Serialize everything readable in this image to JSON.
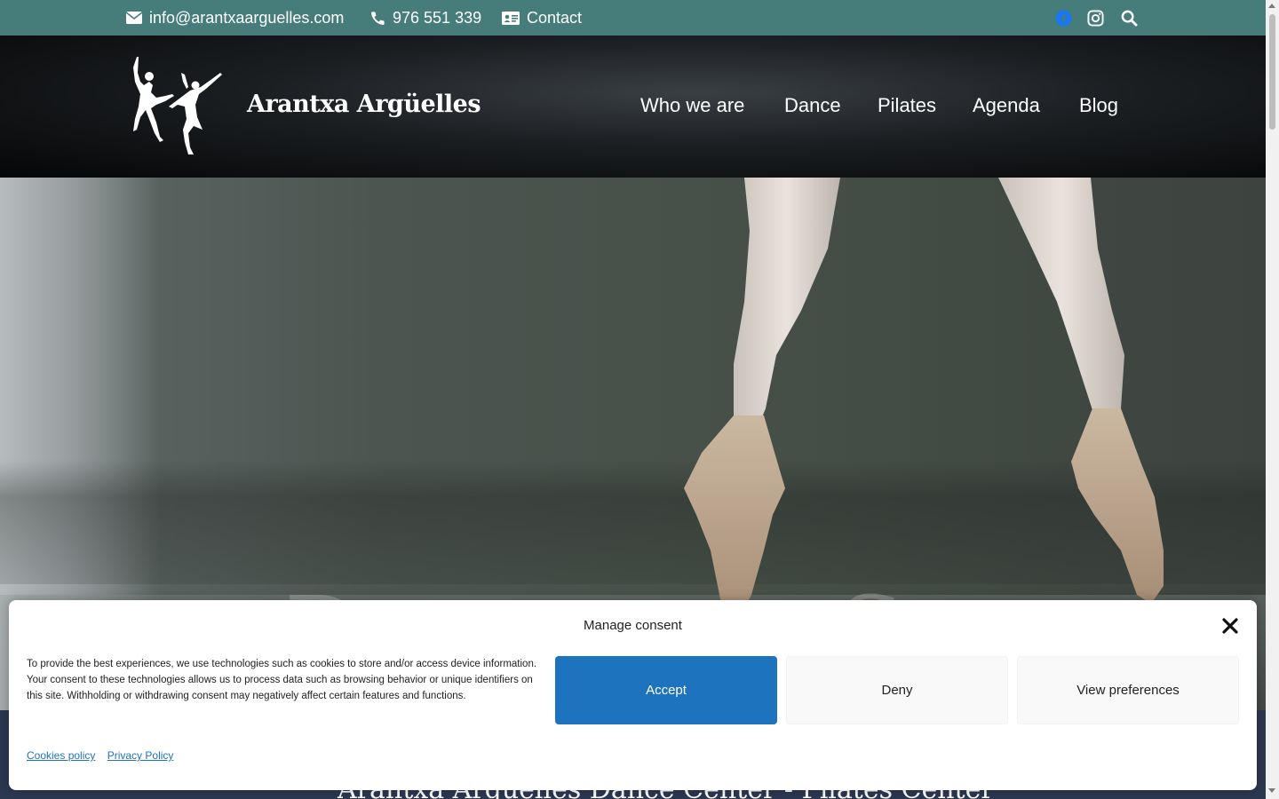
{
  "topbar": {
    "email": "info@arantxaarguelles.com",
    "phone": "976 551 339",
    "contact_label": "Contact",
    "icons": [
      "envelope-icon",
      "phone-icon",
      "id-card-icon",
      "facebook-icon",
      "instagram-icon",
      "search-icon"
    ],
    "colors": {
      "background": "#467c7a",
      "facebook": "#1877f2"
    }
  },
  "header": {
    "brand": "Arantxa Argüelles",
    "logo_icon": "dancers-logo-icon",
    "nav": [
      "Who we are",
      "Dance",
      "Pilates",
      "Agenda",
      "Blog"
    ]
  },
  "hero": {
    "script_text": "Danza Sc"
  },
  "below": {
    "title": "Arantxa Argüelles Dance Center - Pilates Center"
  },
  "consent": {
    "title": "Manage consent",
    "text": "To provide the best experiences, we use technologies such as cookies to store and/or access device information. Your consent to these technologies allows us to process data such as browsing behavior or unique identifiers on this site. Withholding or withdrawing consent may negatively affect certain features and functions.",
    "accept": "Accept",
    "deny": "Deny",
    "view_preferences": "View preferences",
    "links": [
      "Cookies policy",
      "Privacy Policy"
    ],
    "colors": {
      "accept": "#1e73be"
    }
  }
}
